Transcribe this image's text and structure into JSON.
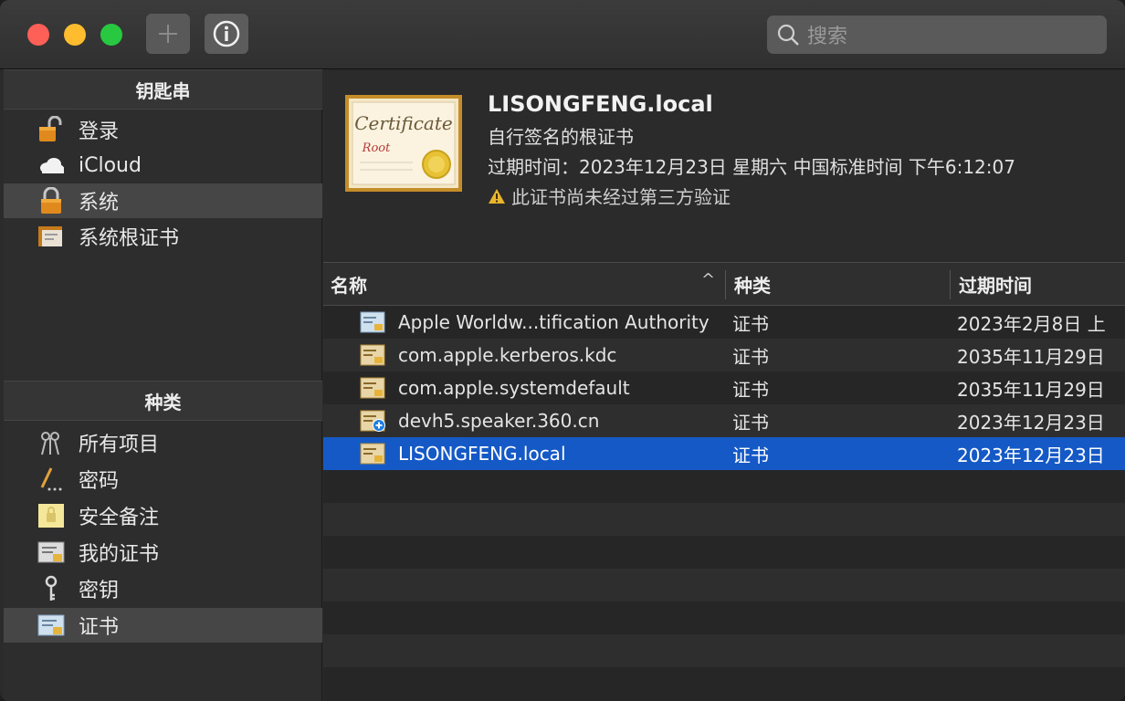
{
  "toolbar": {
    "search_placeholder": "搜索"
  },
  "sidebar": {
    "keychains_header": "钥匙串",
    "keychains": [
      {
        "label": "登录",
        "icon": "unlocked-padlock-icon"
      },
      {
        "label": "iCloud",
        "icon": "cloud-icon"
      },
      {
        "label": "系统",
        "icon": "padlock-icon",
        "selected": true
      },
      {
        "label": "系统根证书",
        "icon": "cabinet-icon"
      }
    ],
    "category_header": "种类",
    "categories": [
      {
        "label": "所有项目",
        "icon": "all-items-icon"
      },
      {
        "label": "密码",
        "icon": "pen-icon"
      },
      {
        "label": "安全备注",
        "icon": "note-icon"
      },
      {
        "label": "我的证书",
        "icon": "my-certificate-icon"
      },
      {
        "label": "密钥",
        "icon": "key-icon"
      },
      {
        "label": "证书",
        "icon": "certificate-icon",
        "selected": true
      }
    ]
  },
  "detail": {
    "title": "LISONGFENG.local",
    "subtitle": "自行签名的根证书",
    "expiry": "过期时间：2023年12月23日 星期六 中国标准时间 下午6:12:07",
    "warning": "此证书尚未经过第三方验证",
    "badge_text_main": "Certificate",
    "badge_text_sub": "Root"
  },
  "table": {
    "columns": {
      "name": "名称",
      "kind": "种类",
      "expiry": "过期时间"
    },
    "rows": [
      {
        "name": "Apple Worldw...tification Authority",
        "kind": "证书",
        "expiry": "2023年2月8日 上",
        "icon": "blue-certificate-icon"
      },
      {
        "name": "com.apple.kerberos.kdc",
        "kind": "证书",
        "expiry": "2035年11月29日",
        "icon": "certificate-icon"
      },
      {
        "name": "com.apple.systemdefault",
        "kind": "证书",
        "expiry": "2035年11月29日",
        "icon": "certificate-icon"
      },
      {
        "name": "devh5.speaker.360.cn",
        "kind": "证书",
        "expiry": "2023年12月23日",
        "icon": "certificate-plus-icon"
      },
      {
        "name": "LISONGFENG.local",
        "kind": "证书",
        "expiry": "2023年12月23日",
        "icon": "certificate-icon",
        "selected": true
      }
    ]
  }
}
